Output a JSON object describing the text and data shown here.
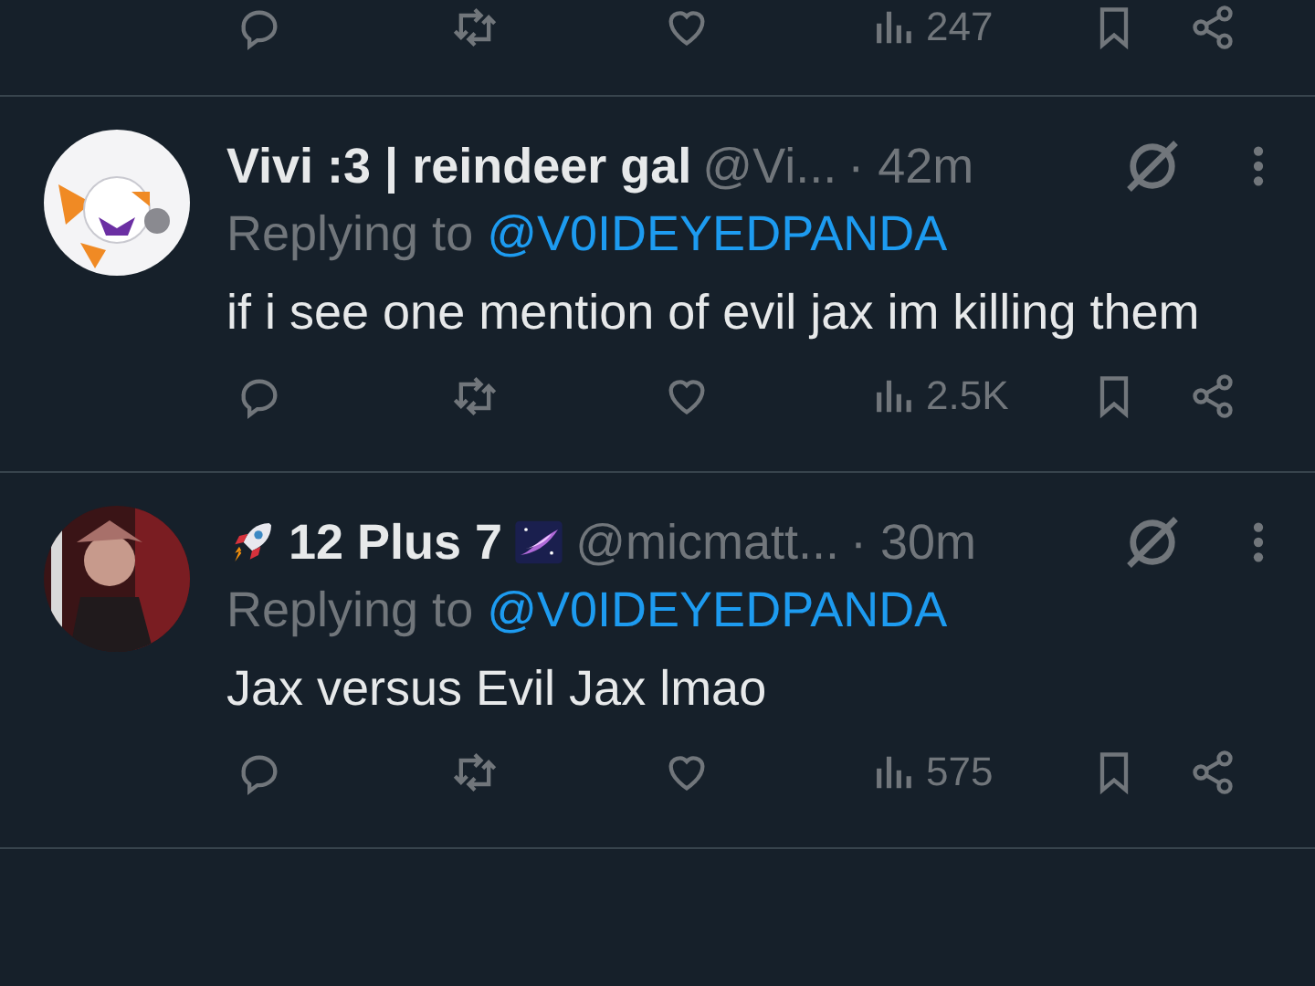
{
  "top_actions": {
    "views": "247"
  },
  "tweets": [
    {
      "avatar": {
        "kind": "picture"
      },
      "name_segments": [
        {
          "kind": "text",
          "text": "Vivi :3 | reindeer gal"
        }
      ],
      "handle": "@Vi...",
      "time": "· 42m",
      "replying_label": "Replying to",
      "replying_to": "@V0IDEYEDPANDA",
      "body": "if i see one mention of evil jax im killing them",
      "views": "2.5K"
    },
    {
      "avatar": {
        "kind": "picture"
      },
      "name_segments": [
        {
          "kind": "rocket"
        },
        {
          "kind": "text",
          "text": "12 Plus 7"
        },
        {
          "kind": "galaxy"
        }
      ],
      "handle": "@micmatt...",
      "time": "· 30m",
      "replying_label": "Replying to",
      "replying_to": "@V0IDEYEDPANDA",
      "body": "Jax versus Evil Jax lmao",
      "views": "575"
    }
  ]
}
